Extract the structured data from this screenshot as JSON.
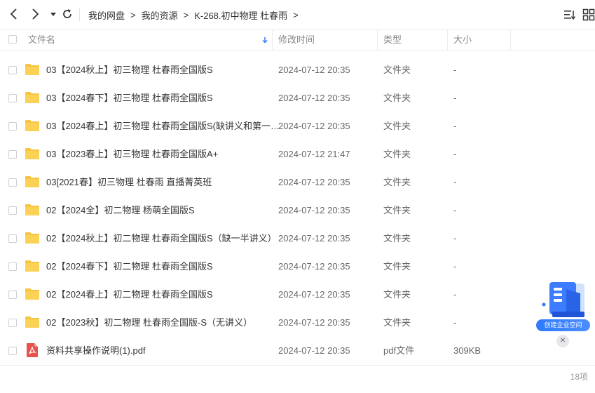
{
  "toolbar": {
    "breadcrumbs": [
      "我的网盘",
      "我的资源",
      "K-268.初中物理 杜春雨"
    ],
    "arrow": ">"
  },
  "table": {
    "headers": {
      "name": "文件名",
      "modified": "修改时间",
      "type": "类型",
      "size": "大小"
    },
    "rows": [
      {
        "name": "03【2024秋上】初三物理 杜春雨全国版S",
        "date": "2024-07-12 20:35",
        "type": "文件夹",
        "size": "-",
        "icon": "folder-icon"
      },
      {
        "name": "03【2024春下】初三物理 杜春雨全国版S",
        "date": "2024-07-12 20:35",
        "type": "文件夹",
        "size": "-",
        "icon": "folder-icon"
      },
      {
        "name": "03【2024春上】初三物理 杜春雨全国版S(缺讲义和第一…",
        "date": "2024-07-12 20:35",
        "type": "文件夹",
        "size": "-",
        "icon": "folder-icon"
      },
      {
        "name": "03【2023春上】初三物理 杜春雨全国版A+",
        "date": "2024-07-12 21:47",
        "type": "文件夹",
        "size": "-",
        "icon": "folder-icon"
      },
      {
        "name": "03[2021春】初三物理 杜春雨 直播菁英班",
        "date": "2024-07-12 20:35",
        "type": "文件夹",
        "size": "-",
        "icon": "folder-icon"
      },
      {
        "name": "02【2024全】初二物理 杨萌全国版S",
        "date": "2024-07-12 20:35",
        "type": "文件夹",
        "size": "-",
        "icon": "folder-icon"
      },
      {
        "name": "02【2024秋上】初二物理 杜春雨全国版S（缺一半讲义）",
        "date": "2024-07-12 20:35",
        "type": "文件夹",
        "size": "-",
        "icon": "folder-icon"
      },
      {
        "name": "02【2024春下】初二物理 杜春雨全国版S",
        "date": "2024-07-12 20:35",
        "type": "文件夹",
        "size": "-",
        "icon": "folder-icon"
      },
      {
        "name": "02【2024春上】初二物理 杜春雨全国版S",
        "date": "2024-07-12 20:35",
        "type": "文件夹",
        "size": "-",
        "icon": "folder-icon"
      },
      {
        "name": "02【2023秋】初二物理  杜春雨全国版-S（无讲义）",
        "date": "2024-07-12 20:35",
        "type": "文件夹",
        "size": "-",
        "icon": "folder-icon"
      },
      {
        "name": "资料共享操作说明(1).pdf",
        "date": "2024-07-12 20:35",
        "type": "pdf文件",
        "size": "309KB",
        "icon": "pdf-icon"
      }
    ]
  },
  "footer": {
    "count": "18项"
  },
  "promo": {
    "label": "创建企业空间",
    "close": "✕"
  },
  "colors": {
    "folder": "#f7c542",
    "accent": "#2f7bff",
    "pdf": "#e5534b"
  }
}
